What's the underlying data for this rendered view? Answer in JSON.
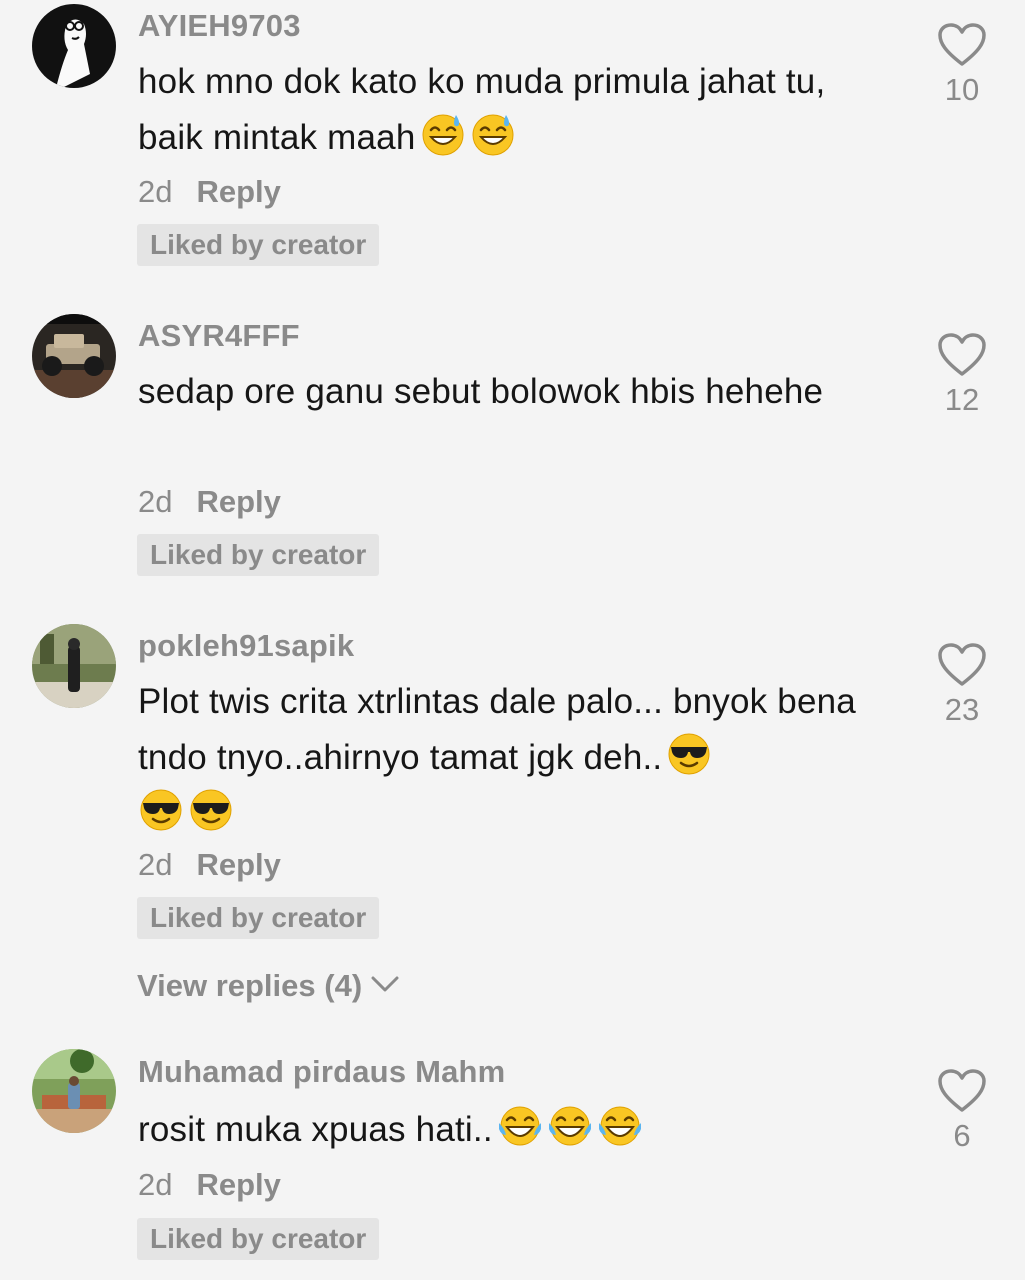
{
  "comments": [
    {
      "username": "AYIEH9703",
      "text": "hok mno dok kato ko muda primula jahat tu, baik mintak maah",
      "emojis": [
        "sweat-smile-emoji",
        "sweat-smile-emoji"
      ],
      "time": "2d",
      "reply_label": "Reply",
      "badge": "Liked by creator",
      "likes": "10"
    },
    {
      "username": "ASYR4FFF",
      "text": "sedap ore ganu sebut bolowok hbis hehehe",
      "emojis": [],
      "time": "2d",
      "reply_label": "Reply",
      "badge": "Liked by creator",
      "likes": "12"
    },
    {
      "username": "pokleh91sapik",
      "text": "Plot twis crita xtrlintas dale palo... bnyok bena tndo tnyo..ahirnyo tamat jgk deh..",
      "emojis": [
        "sunglasses-emoji",
        "sunglasses-emoji",
        "sunglasses-emoji"
      ],
      "time": "2d",
      "reply_label": "Reply",
      "badge": "Liked by creator",
      "likes": "23",
      "view_replies": "View replies (4)"
    },
    {
      "username": "Muhamad pirdaus Mahm",
      "text": "rosit muka xpuas hati..",
      "emojis": [
        "tears-of-joy-emoji",
        "tears-of-joy-emoji",
        "tears-of-joy-emoji"
      ],
      "time": "2d",
      "reply_label": "Reply",
      "badge": "Liked by creator",
      "likes": "6"
    }
  ],
  "colors": {
    "background": "#f4f4f4",
    "text": "#161616",
    "muted": "#8a8a8a",
    "badge_bg": "#e4e4e4"
  }
}
